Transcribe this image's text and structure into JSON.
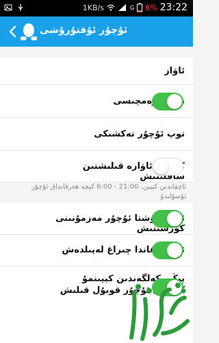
{
  "status_bar": {
    "speed": "1KB/s",
    "network": "G",
    "battery": "6%",
    "time": "23:22",
    "icons": [
      "photo-icon",
      "usb-icon",
      "wifi-icon",
      "signal-icon",
      "battery-icon"
    ]
  },
  "header": {
    "title": "ئۇچۇر ئۇقتۇرۇشى",
    "back_icon": "chevron-left-icon",
    "logo_icon": "qq-penguin-icon",
    "bg_color": "#1aa0e8"
  },
  "settings": {
    "item1": {
      "label": "ئاۋاز"
    },
    "item2": {
      "label": "توپ يارەمچىسى",
      "enabled": true
    },
    "item3": {
      "label": "توپ ئۇچۇر تەكشىكى"
    },
    "item4": {
      "label": "كېچىدە ئاۋازە قىلىشتىن ساقلىنىش",
      "enabled": false
    },
    "hint": "ئاچقاندىن كېيىن، 21:00 - 6:00 كېچە ھەرقانداق ئۇچۇر تۇسۇلىدۇ",
    "item5": {
      "label": "ئۇقتۇرۇشتا ئۇچۇر مەزمۇنىنى كۆرسىتىش",
      "enabled": true
    },
    "item6": {
      "label": "ئۇقتۇرغاندا چىراغ لەپىلدەش",
      "enabled": true
    },
    "item7": {
      "label": "يېڭى كەلگەندىن كېيىنمۇ كەلگەن ئۇچۇر قوبۇل قىلىش",
      "enabled": true
    }
  },
  "accent_color": "#43c04a",
  "watermark_text": "ئالتۇن تۈۋرۈكى"
}
